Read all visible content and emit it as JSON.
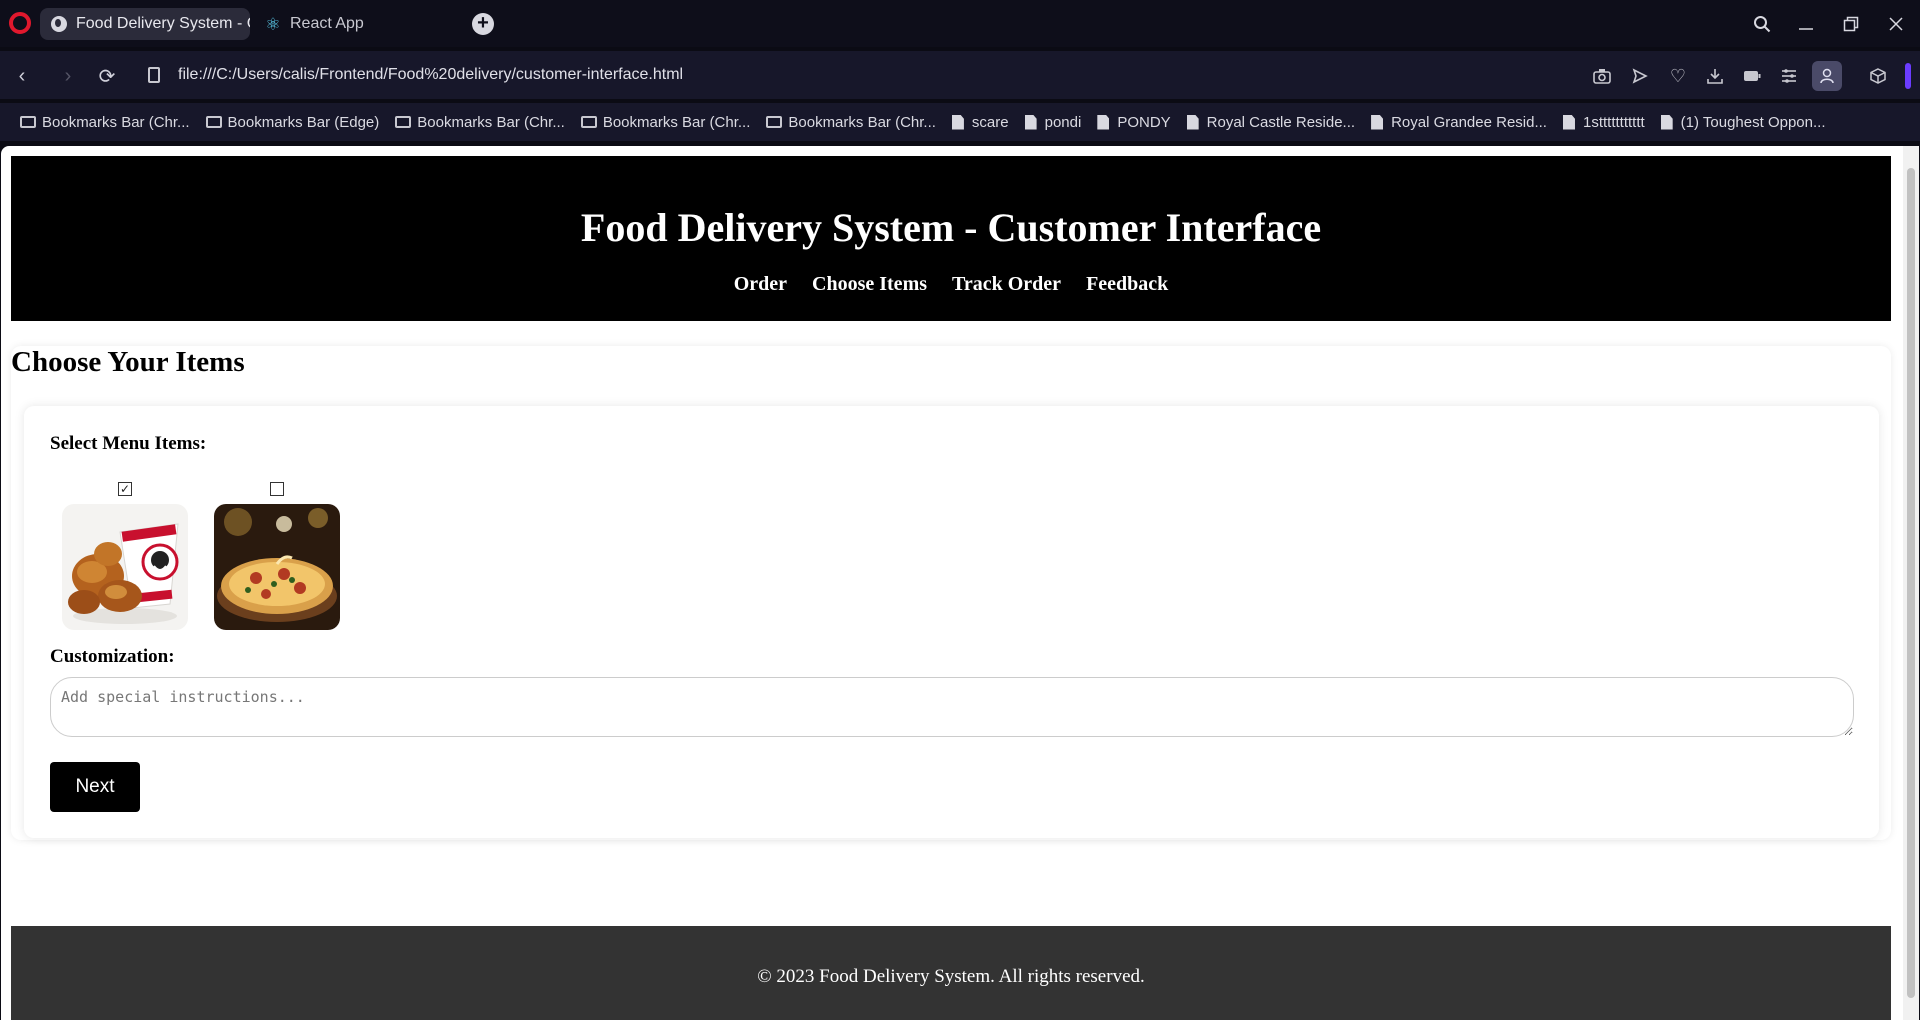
{
  "browser": {
    "tabs": [
      {
        "title": "Food Delivery System - Cu",
        "active": true
      },
      {
        "title": "React App",
        "active": false
      }
    ],
    "address": "file:///C:/Users/calis/Frontend/Food%20delivery/customer-interface.html",
    "bookmarks": [
      {
        "label": "Bookmarks Bar (Chr...",
        "type": "folder"
      },
      {
        "label": "Bookmarks Bar (Edge)",
        "type": "folder"
      },
      {
        "label": "Bookmarks Bar (Chr...",
        "type": "folder"
      },
      {
        "label": "Bookmarks Bar (Chr...",
        "type": "folder"
      },
      {
        "label": "Bookmarks Bar (Chr...",
        "type": "folder"
      },
      {
        "label": "scare",
        "type": "page"
      },
      {
        "label": "pondi",
        "type": "page"
      },
      {
        "label": "PONDY",
        "type": "page"
      },
      {
        "label": "Royal Castle Reside...",
        "type": "page"
      },
      {
        "label": "Royal Grandee Resid...",
        "type": "page"
      },
      {
        "label": "1sttttttttttt",
        "type": "page"
      },
      {
        "label": "(1) Toughest Oppon...",
        "type": "page"
      }
    ],
    "accent_color": "#6b3cff"
  },
  "site": {
    "title": "Food Delivery System - Customer Interface",
    "nav": [
      "Order",
      "Choose Items",
      "Track Order",
      "Feedback"
    ]
  },
  "choose_items": {
    "heading": "Choose Your Items",
    "select_label": "Select Menu Items:",
    "items": [
      {
        "name": "fried-chicken-bucket",
        "checked": true
      },
      {
        "name": "pizza",
        "checked": false
      }
    ],
    "customization_label": "Customization:",
    "customization_placeholder": "Add special instructions...",
    "next_label": "Next"
  },
  "footer": {
    "text": "© 2023 Food Delivery System. All rights reserved."
  }
}
